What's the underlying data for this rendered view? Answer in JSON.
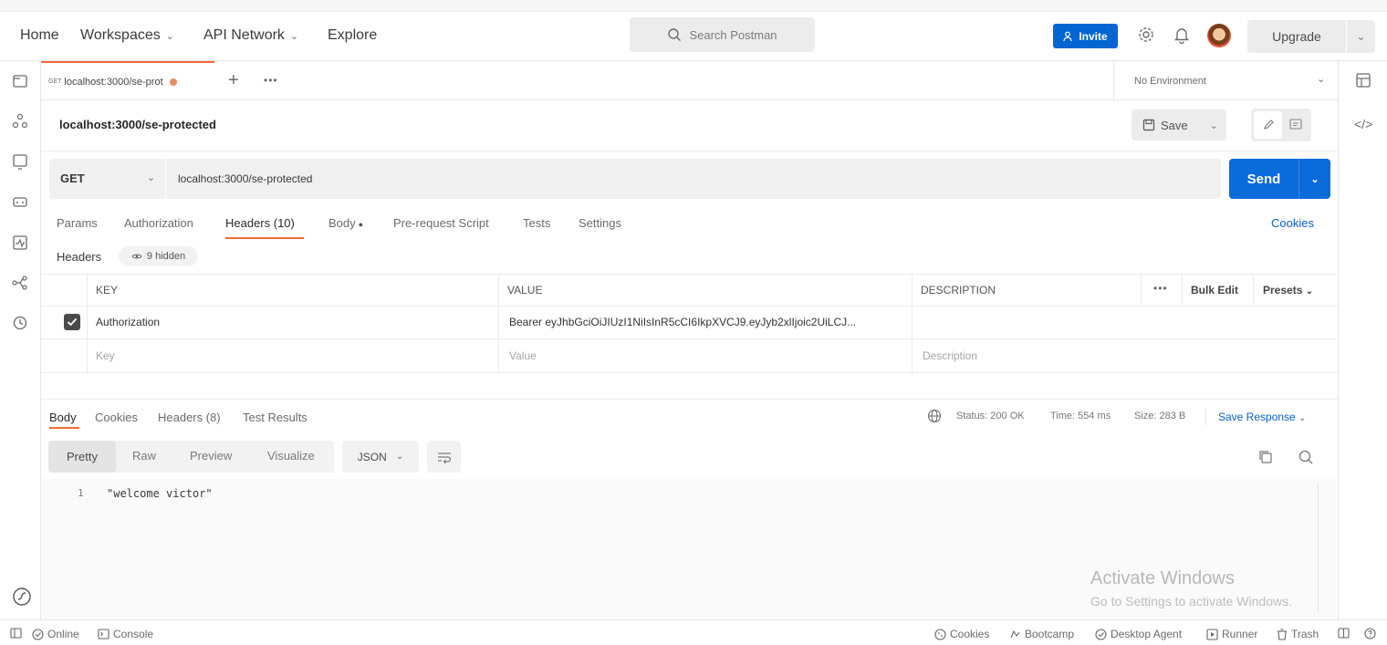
{
  "header": {
    "nav": [
      "Home",
      "Workspaces",
      "API Network",
      "Explore"
    ],
    "search_placeholder": "Search Postman",
    "invite_label": "Invite",
    "upgrade_label": "Upgrade"
  },
  "tabs": {
    "active_tab": {
      "method": "GET",
      "label": "localhost:3000/se-prot"
    },
    "environment": "No Environment"
  },
  "request": {
    "title": "localhost:3000/se-protected",
    "save_label": "Save",
    "method": "GET",
    "url": "localhost:3000/se-protected",
    "send_label": "Send",
    "tabs": [
      "Params",
      "Authorization",
      "Headers (10)",
      "Body",
      "Pre-request Script",
      "Tests",
      "Settings"
    ],
    "active_tab": "Headers (10)",
    "cookies_label": "Cookies",
    "headers_label": "Headers",
    "hidden_label": "9 hidden"
  },
  "headers_table": {
    "columns": [
      "KEY",
      "VALUE",
      "DESCRIPTION"
    ],
    "bulk_edit": "Bulk Edit",
    "presets": "Presets",
    "rows": [
      {
        "checked": true,
        "key": "Authorization",
        "value": "Bearer eyJhbGciOiJIUzI1NiIsInR5cCI6IkpXVCJ9.eyJyb2xlIjoic2UiLCJ...",
        "description": ""
      }
    ],
    "placeholder": {
      "key": "Key",
      "value": "Value",
      "description": "Description"
    }
  },
  "response": {
    "tabs": [
      "Body",
      "Cookies",
      "Headers (8)",
      "Test Results"
    ],
    "active_tab": "Body",
    "status": "Status: 200 OK",
    "time": "Time: 554 ms",
    "size": "Size: 283 B",
    "save_response": "Save Response",
    "formats": [
      "Pretty",
      "Raw",
      "Preview",
      "Visualize"
    ],
    "active_format": "Pretty",
    "language": "JSON",
    "lines": [
      {
        "number": "1",
        "text": "\"welcome victor\""
      }
    ]
  },
  "watermark": {
    "title": "Activate Windows",
    "subtitle": "Go to Settings to activate Windows."
  },
  "statusbar": {
    "left": [
      "Online",
      "Console"
    ],
    "right": [
      "Cookies",
      "Bootcamp",
      "Desktop Agent",
      "Runner",
      "Trash"
    ]
  },
  "colors": {
    "accent_orange": "#f26b3a",
    "primary_blue": "#0a6bdb",
    "link_blue": "#0b5fbf"
  }
}
